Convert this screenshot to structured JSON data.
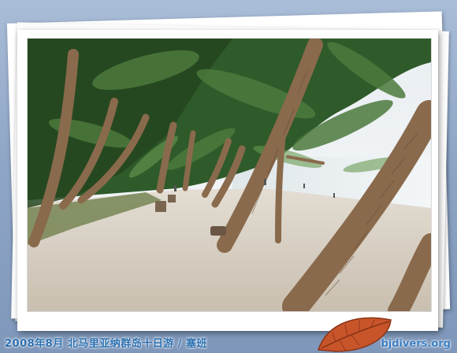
{
  "caption": "2008年8月 北马里亚纳群岛十日游 / 塞班",
  "watermark": "bjdivers.org",
  "colors": {
    "background": "#8fa6c6",
    "frame": "#ffffff",
    "caption_text": "#2a6fb0",
    "sand": "#d9d2c6",
    "palm_trunk": "#8a6a4c",
    "foliage": "#2f5a2a"
  },
  "icons": {
    "decoration": "autumn-leaf-icon"
  }
}
